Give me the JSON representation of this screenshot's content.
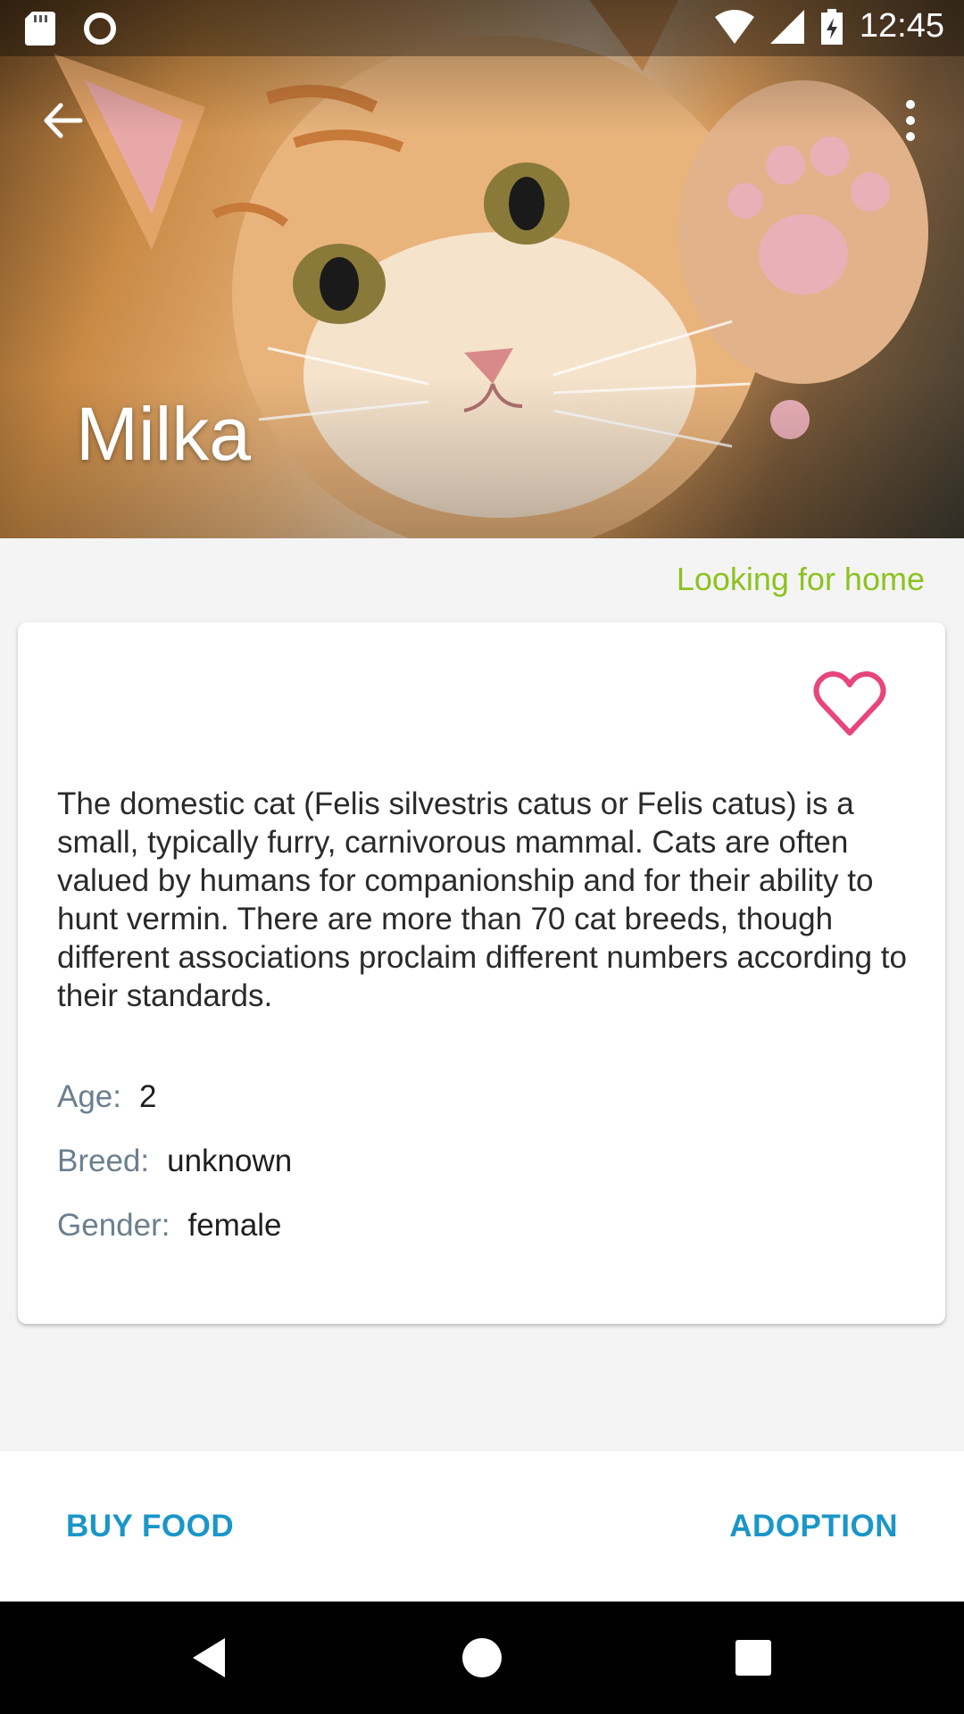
{
  "status_bar": {
    "time": "12:45",
    "icons": [
      "sd-card-icon",
      "sync-icon",
      "wifi-icon",
      "signal-icon",
      "battery-charging-icon"
    ]
  },
  "app_bar": {
    "back_icon": "arrow-back-icon",
    "menu_icon": "more-vert-icon"
  },
  "hero": {
    "title": "Milka"
  },
  "status_tag": "Looking for home",
  "card": {
    "favorite_icon": "heart-outline-icon",
    "favorite_color": "#e8457a",
    "description": "The domestic cat (Felis silvestris catus or Felis catus) is a small, typically furry, carnivorous mammal. Cats are often valued by humans for companionship and for their ability to hunt vermin. There are more than 70 cat breeds, though different associations proclaim different numbers according to their standards.",
    "details": [
      {
        "label": "Age:",
        "value": "2"
      },
      {
        "label": "Breed:",
        "value": "unknown"
      },
      {
        "label": "Gender:",
        "value": "female"
      }
    ]
  },
  "actions": {
    "buy_food": "BUY FOOD",
    "adoption": "ADOPTION",
    "accent_color": "#1a96c8"
  },
  "nav_bar": {
    "icons": [
      "nav-back-icon",
      "nav-home-icon",
      "nav-recents-icon"
    ]
  }
}
